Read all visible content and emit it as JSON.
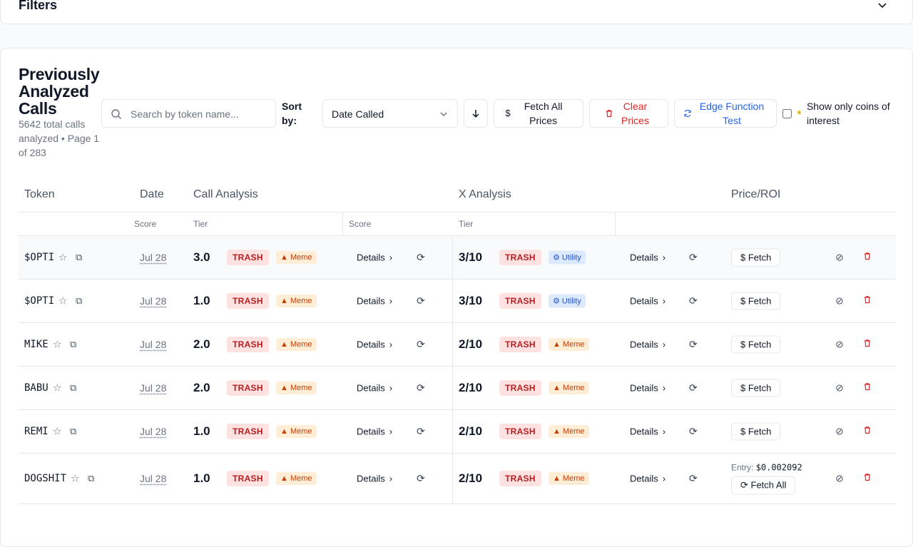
{
  "filters": {
    "title": "Filters"
  },
  "header": {
    "title": "Previously Analyzed Calls",
    "subtitle": "5642 total calls analyzed • Page 1 of 283"
  },
  "toolbar": {
    "search_placeholder": "Search by token name...",
    "sort_label": "Sort by:",
    "sort_value": "Date Called",
    "fetch_all_label": "Fetch All Prices",
    "clear_label": "Clear Prices",
    "edge_label": "Edge Function Test",
    "coins_label": "Show only coins of interest"
  },
  "table": {
    "headers": [
      "Token",
      "Date",
      "Call Analysis",
      "X Analysis",
      "Price/ROI"
    ],
    "subheaders": {
      "score": "Score",
      "tier": "Tier",
      "x_score": "Score",
      "x_tier": "Tier"
    },
    "details_label": "Details",
    "fetch_label": "Fetch",
    "fetch_all_label": "Fetch All",
    "entry_label": "Entry:",
    "rows": [
      {
        "token": "$OPTI",
        "date": "Jul 28",
        "score": "3.0",
        "tier": "TRASH",
        "category": "Meme",
        "x_score": "3/10",
        "x_tier": "TRASH",
        "x_category": "Utility"
      },
      {
        "token": "$OPTI",
        "date": "Jul 28",
        "score": "1.0",
        "tier": "TRASH",
        "category": "Meme",
        "x_score": "3/10",
        "x_tier": "TRASH",
        "x_category": "Utility"
      },
      {
        "token": "MIKE",
        "date": "Jul 28",
        "score": "2.0",
        "tier": "TRASH",
        "category": "Meme",
        "x_score": "2/10",
        "x_tier": "TRASH",
        "x_category": "Meme"
      },
      {
        "token": "BABU",
        "date": "Jul 28",
        "score": "2.0",
        "tier": "TRASH",
        "category": "Meme",
        "x_score": "2/10",
        "x_tier": "TRASH",
        "x_category": "Meme"
      },
      {
        "token": "REMI",
        "date": "Jul 28",
        "score": "1.0",
        "tier": "TRASH",
        "category": "Meme",
        "x_score": "2/10",
        "x_tier": "TRASH",
        "x_category": "Meme"
      },
      {
        "token": "DOGSHIT",
        "date": "Jul 28",
        "score": "1.0",
        "tier": "TRASH",
        "category": "Meme",
        "x_score": "2/10",
        "x_tier": "TRASH",
        "x_category": "Meme",
        "entry": "$0.002092"
      }
    ]
  }
}
